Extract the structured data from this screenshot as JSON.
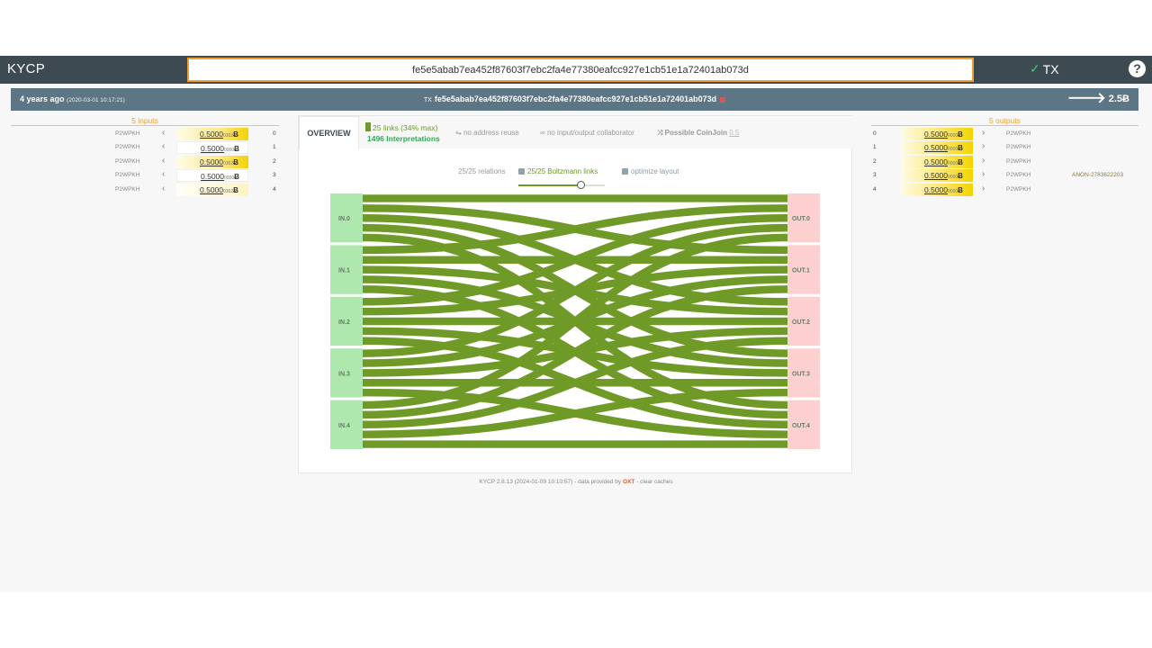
{
  "topbar": {
    "brand": "KYCP",
    "search_value": "fe5e5abab7ea452f87603f7ebc2fa4e77380eafcc927e1cb51e1a72401ab073d",
    "mode_label": "TX",
    "help_label": "?"
  },
  "summary": {
    "age": "4 years ago",
    "datetime": "(2020-03-01 10:17:21)",
    "txid_prefix": "TX",
    "txid": "fe5e5abab7ea452f87603f7ebc2fa4e77380eafcc927e1cb51e1a72401ab073d",
    "total": "2.5Ƀ"
  },
  "inputs": {
    "header": "5 inputs",
    "rows": [
      {
        "type": "P2WPKH",
        "main": "0.5000",
        "small": "0362",
        "unit": "Ƀ",
        "index": "0"
      },
      {
        "type": "P2WPKH",
        "main": "0.5000",
        "small": "0000",
        "unit": "Ƀ",
        "index": "1"
      },
      {
        "type": "P2WPKH",
        "main": "0.5000",
        "small": "0362",
        "unit": "Ƀ",
        "index": "2"
      },
      {
        "type": "P2WPKH",
        "main": "0.5000",
        "small": "0000",
        "unit": "Ƀ",
        "index": "3"
      },
      {
        "type": "P2WPKH",
        "main": "0.5000",
        "small": "0362",
        "unit": "Ƀ",
        "index": "4"
      }
    ]
  },
  "outputs": {
    "header": "5 outputs",
    "rows": [
      {
        "type": "P2WPKH",
        "main": "0.5000",
        "small": "0000",
        "unit": "Ƀ",
        "index": "0"
      },
      {
        "type": "P2WPKH",
        "main": "0.5000",
        "small": "0000",
        "unit": "Ƀ",
        "index": "1"
      },
      {
        "type": "P2WPKH",
        "main": "0.5000",
        "small": "0000",
        "unit": "Ƀ",
        "index": "2"
      },
      {
        "type": "P2WPKH",
        "main": "0.5000",
        "small": "0000",
        "unit": "Ƀ",
        "index": "3"
      },
      {
        "type": "P2WPKH",
        "main": "0.5000",
        "small": "0000",
        "unit": "Ƀ",
        "index": "4"
      }
    ],
    "anon_label": "ANON-2783622203"
  },
  "overview": {
    "tab_label": "OVERVIEW",
    "links": "25 links (34% max)",
    "interpretations": "1496 Interpretations",
    "flag_reuse": "no address reuse",
    "flag_collab": "no input/output collaborator",
    "flag_coinjoin": "Possible CoinJoin",
    "coinjoin_score": "0.5",
    "relations": "25/25 relations",
    "boltzmann": "25/25 Boltzmann links",
    "optimize": "optimize layout",
    "slider_value": 0.72
  },
  "sankey": {
    "inputs": [
      "IN.0",
      "IN.1",
      "IN.2",
      "IN.3",
      "IN.4"
    ],
    "outputs": [
      "OUT.0",
      "OUT.1",
      "OUT.2",
      "OUT.3",
      "OUT.4"
    ],
    "colors": {
      "link": "#6f9a28",
      "input_node": "#aee8ae",
      "output_node": "#fdd0d0"
    }
  },
  "footer": {
    "pre": "KYCP 2.8.13 (2024-01-09 10:10:57) - data provided by ",
    "provider": "OXT",
    "post": " - clear caches"
  }
}
